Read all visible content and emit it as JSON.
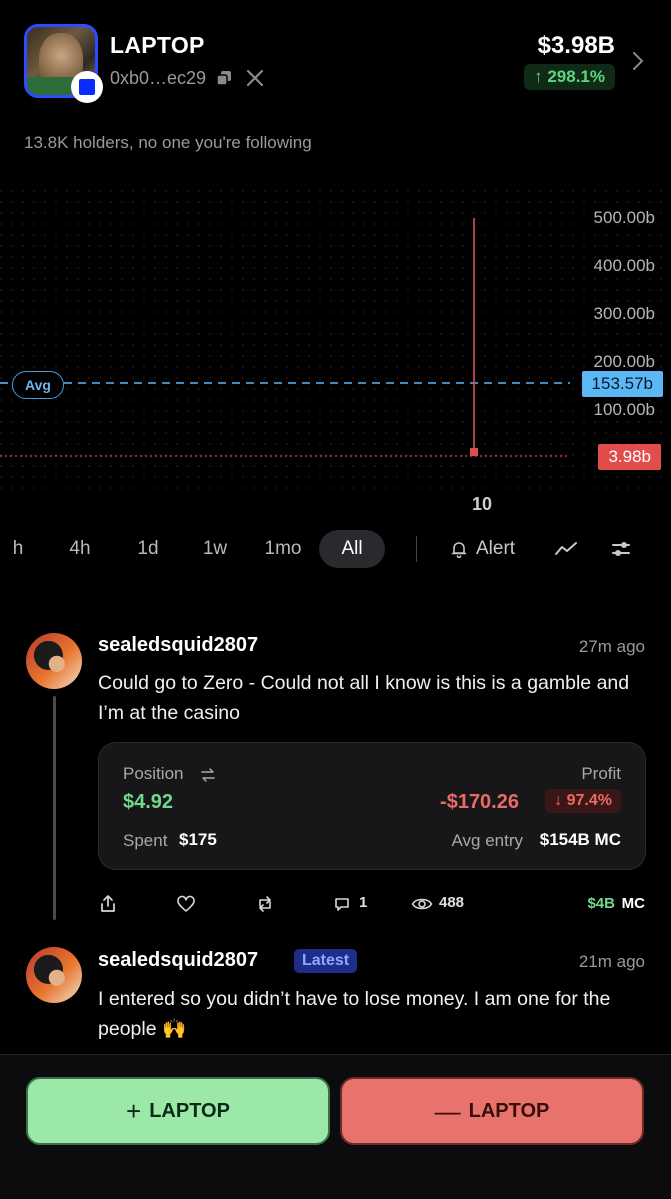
{
  "token": {
    "name": "LAPTOP",
    "address": "0xb0…ec29",
    "market_cap": "$3.98B",
    "change": "↑ 298.1%"
  },
  "holders_text": "13.8K holders, no one you're following",
  "chart": {
    "y_ticks": [
      "500.00b",
      "400.00b",
      "300.00b",
      "200.00b",
      "100.00b"
    ],
    "avg_label": "Avg",
    "avg_value": "153.57b",
    "current_value": "3.98b",
    "x_tick": "10",
    "colors": {
      "avg": "#5cb8f5",
      "current": "#e04d4a"
    }
  },
  "timeframes": {
    "items": [
      "h",
      "4h",
      "1d",
      "1w",
      "1mo",
      "All"
    ],
    "active": "All",
    "alert_label": "Alert"
  },
  "posts": [
    {
      "username": "sealedsquid2807",
      "time": "27m ago",
      "text": "Could go to Zero - Could not all I know is this is a gamble and I’m at the casino",
      "position": {
        "position_label": "Position",
        "position_value": "$4.92",
        "profit_label": "Profit",
        "profit_value": "-$170.26",
        "profit_pct": "↓ 97.4%",
        "spent_label": "Spent",
        "spent_value": "$175",
        "avg_entry_label": "Avg entry",
        "avg_entry_value": "$154B MC"
      },
      "actions": {
        "replies": "1",
        "views": "488",
        "mc_value": "$4B",
        "mc_label": "MC"
      }
    },
    {
      "username": "sealedsquid2807",
      "badge": "Latest",
      "time": "21m ago",
      "text": "I entered so you didn’t have to lose money. I am one for the people 🙌"
    }
  ],
  "bottom": {
    "buy_label": "LAPTOP",
    "buy_sign": "+",
    "sell_label": "LAPTOP",
    "sell_sign": "—"
  },
  "icons": [
    "copy-icon",
    "x-logo-icon",
    "chevron-right-icon",
    "bell-icon",
    "line-chart-icon",
    "settings-sliders-icon",
    "swap-icon",
    "share-icon",
    "heart-icon",
    "repost-icon",
    "reply-icon",
    "eye-icon"
  ]
}
